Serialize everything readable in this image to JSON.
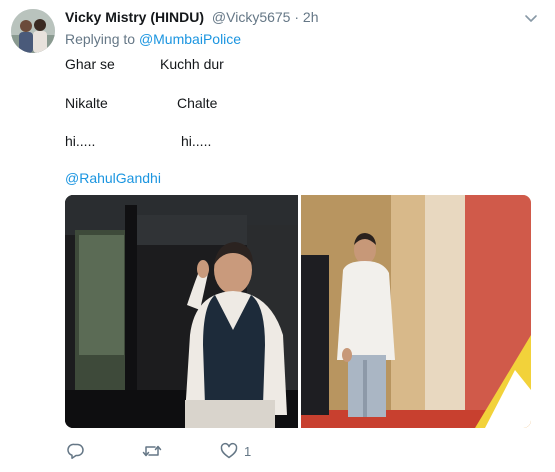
{
  "tweet": {
    "author_name": "Vicky Mistry (HINDU)",
    "handle": "@Vicky5675",
    "separator": "·",
    "time": "2h",
    "replying_prefix": "Replying to",
    "replying_to": "@MumbaiPolice",
    "lines": [
      {
        "left": "Ghar se",
        "right": "Kuchh dur"
      },
      {
        "left": "Nikalte",
        "right": "Chalte"
      },
      {
        "left": "hi.....",
        "right": "hi....."
      }
    ],
    "mention": "@RahulGandhi",
    "actions": {
      "reply_icon": "reply-icon",
      "retweet_icon": "retweet-icon",
      "like_icon": "heart-icon",
      "like_count": "1"
    }
  }
}
